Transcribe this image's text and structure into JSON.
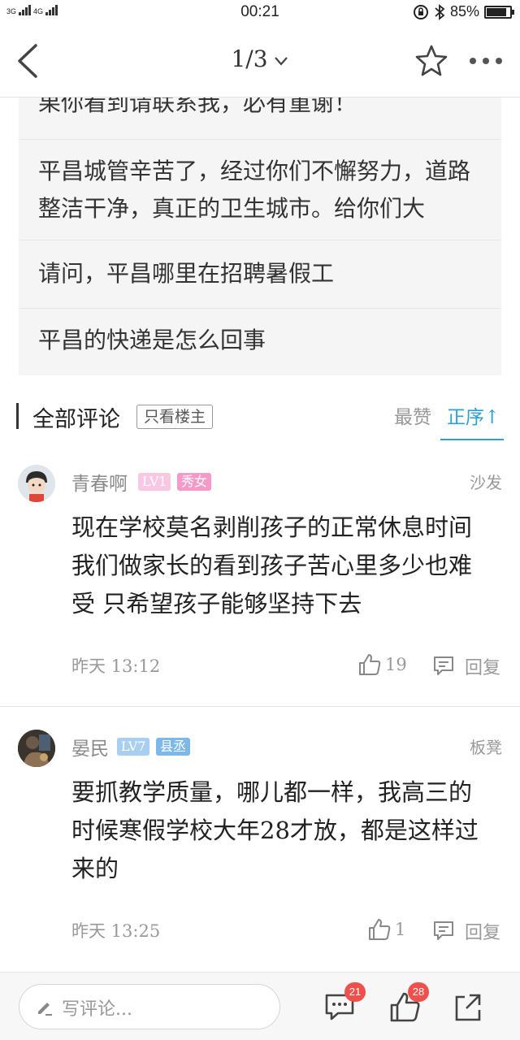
{
  "status_bar": {
    "network_left": "3G",
    "network_right": "4G",
    "time": "00:21",
    "battery_percent": "85%",
    "battery_level": 0.85
  },
  "header": {
    "page_indicator": "1/3"
  },
  "related_topics": [
    "果你看到请联系我，必有重谢！",
    "平昌城管辛苦了，经过你们不懈努力，道路整洁干净，真正的卫生城市。给你们大",
    "请问，平昌哪里在招聘暑假工",
    "平昌的快递是怎么回事"
  ],
  "comments_header": {
    "title": "全部评论",
    "only_host": "只看楼主",
    "sort_likes": "最赞",
    "sort_asc": "正序↑"
  },
  "comments": [
    {
      "username": "青春啊",
      "level": "LV1",
      "title": "秀女",
      "floor": "沙发",
      "body": "现在学校莫名剥削孩子的正常休息时间 我们做家长的看到孩子苦心里多少也难受 只希望孩子能够坚持下去",
      "time": "昨天 13:12",
      "likes": "19",
      "reply": "回复"
    },
    {
      "username": "晏民",
      "level": "LV7",
      "title": "县丞",
      "floor": "板凳",
      "body": "要抓教学质量，哪儿都一样，我高三的时候寒假学校大年28才放，都是这样过来的",
      "time": "昨天 13:25",
      "likes": "1",
      "reply": "回复"
    }
  ],
  "bottom_bar": {
    "placeholder": "写评论...",
    "comment_count": "21",
    "like_count": "28"
  },
  "colors": {
    "accent": "#2a9fd8",
    "badge_pink": "#f6a9d2",
    "badge_blue": "#8fc3ee",
    "notification_red": "#f0504b"
  }
}
